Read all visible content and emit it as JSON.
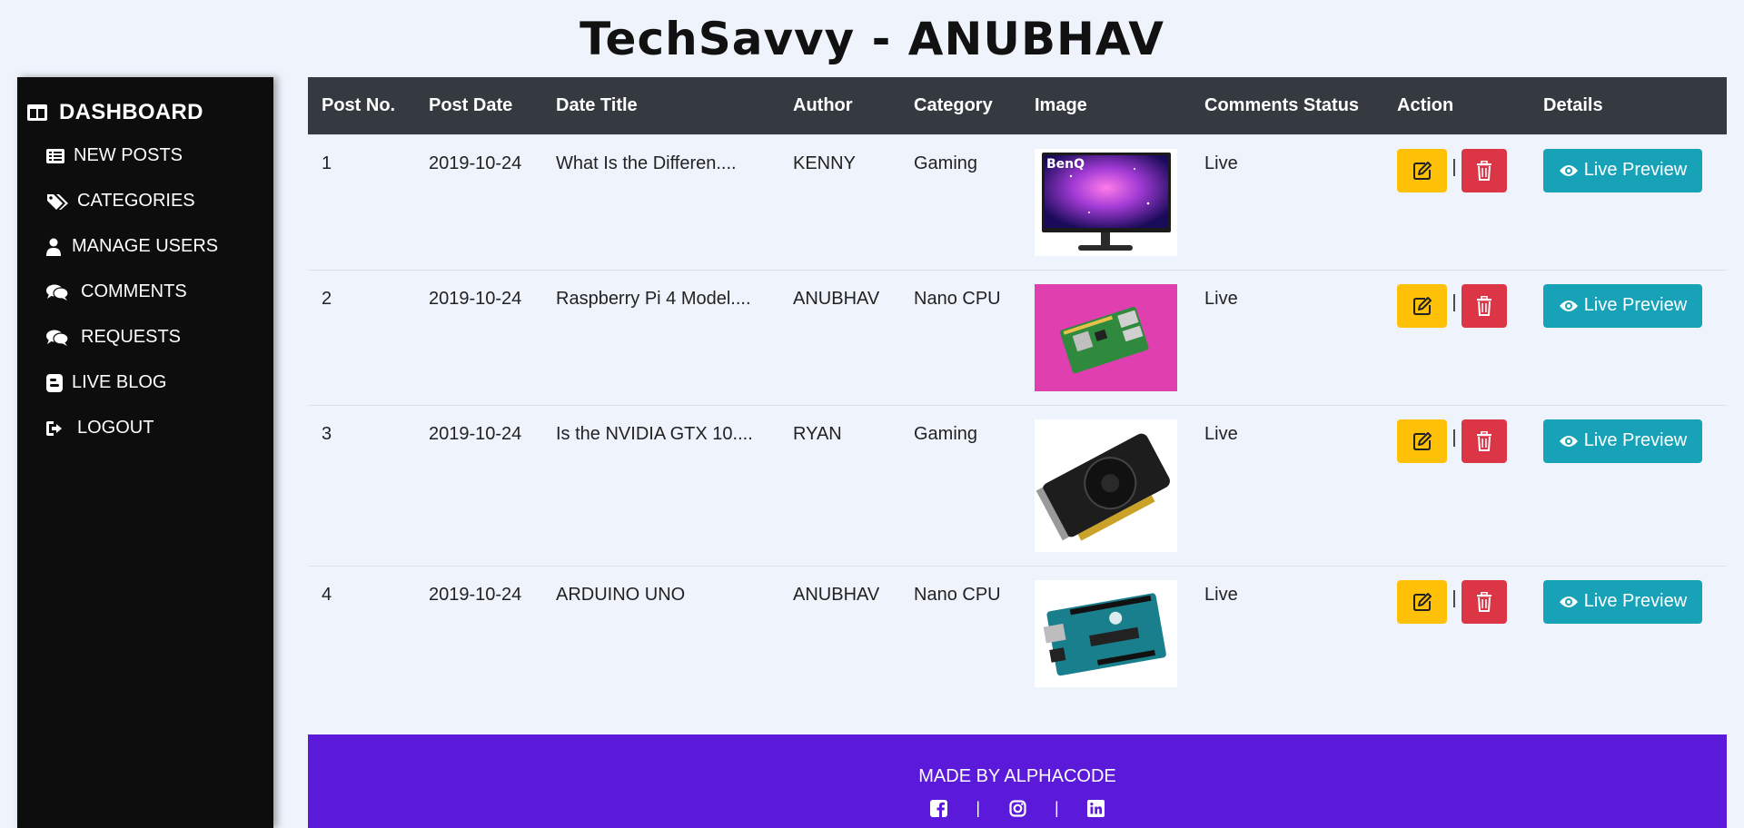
{
  "header": {
    "title": "TechSavvy - ANUBHAV"
  },
  "sidebar": {
    "heading": "DASHBOARD",
    "items": [
      {
        "label": "NEW POSTS",
        "icon": "list-icon"
      },
      {
        "label": "CATEGORIES",
        "icon": "tags-icon"
      },
      {
        "label": "MANAGE USERS",
        "icon": "user-icon"
      },
      {
        "label": "COMMENTS",
        "icon": "comments-icon"
      },
      {
        "label": "REQUESTS",
        "icon": "comments-icon"
      },
      {
        "label": "LIVE BLOG",
        "icon": "blog-icon"
      },
      {
        "label": "LOGOUT",
        "icon": "sign-out-icon"
      }
    ]
  },
  "table": {
    "columns": [
      "Post No.",
      "Post Date",
      "Date Title",
      "Author",
      "Category",
      "Image",
      "Comments Status",
      "Action",
      "Details"
    ],
    "rows": [
      {
        "no": "1",
        "date": "2019-10-24",
        "title": "What Is the Differen....",
        "author": "KENNY",
        "category": "Gaming",
        "image": "monitor",
        "status": "Live",
        "details": "Live Preview"
      },
      {
        "no": "2",
        "date": "2019-10-24",
        "title": "Raspberry Pi 4 Model....",
        "author": "ANUBHAV",
        "category": "Nano CPU",
        "image": "raspberry-pi",
        "status": "Live",
        "details": "Live Preview"
      },
      {
        "no": "3",
        "date": "2019-10-24",
        "title": "Is the NVIDIA GTX 10....",
        "author": "RYAN",
        "category": "Gaming",
        "image": "graphics-card",
        "status": "Live",
        "details": "Live Preview"
      },
      {
        "no": "4",
        "date": "2019-10-24",
        "title": "ARDUINO UNO",
        "author": "ANUBHAV",
        "category": "Nano CPU",
        "image": "arduino",
        "status": "Live",
        "details": "Live Preview"
      }
    ],
    "separator": "|"
  },
  "images": {
    "monitor_logo": "BenQ"
  },
  "footer": {
    "text": "MADE BY ALPHACODE",
    "separator": "|"
  },
  "colors": {
    "page_bg": "#eef3fc",
    "sidebar_bg": "#0d0d0d",
    "table_header_bg": "#343a40",
    "edit": "#ffc107",
    "delete": "#dc3545",
    "preview": "#17a2b8",
    "footer_bg": "#5b1ad9"
  }
}
